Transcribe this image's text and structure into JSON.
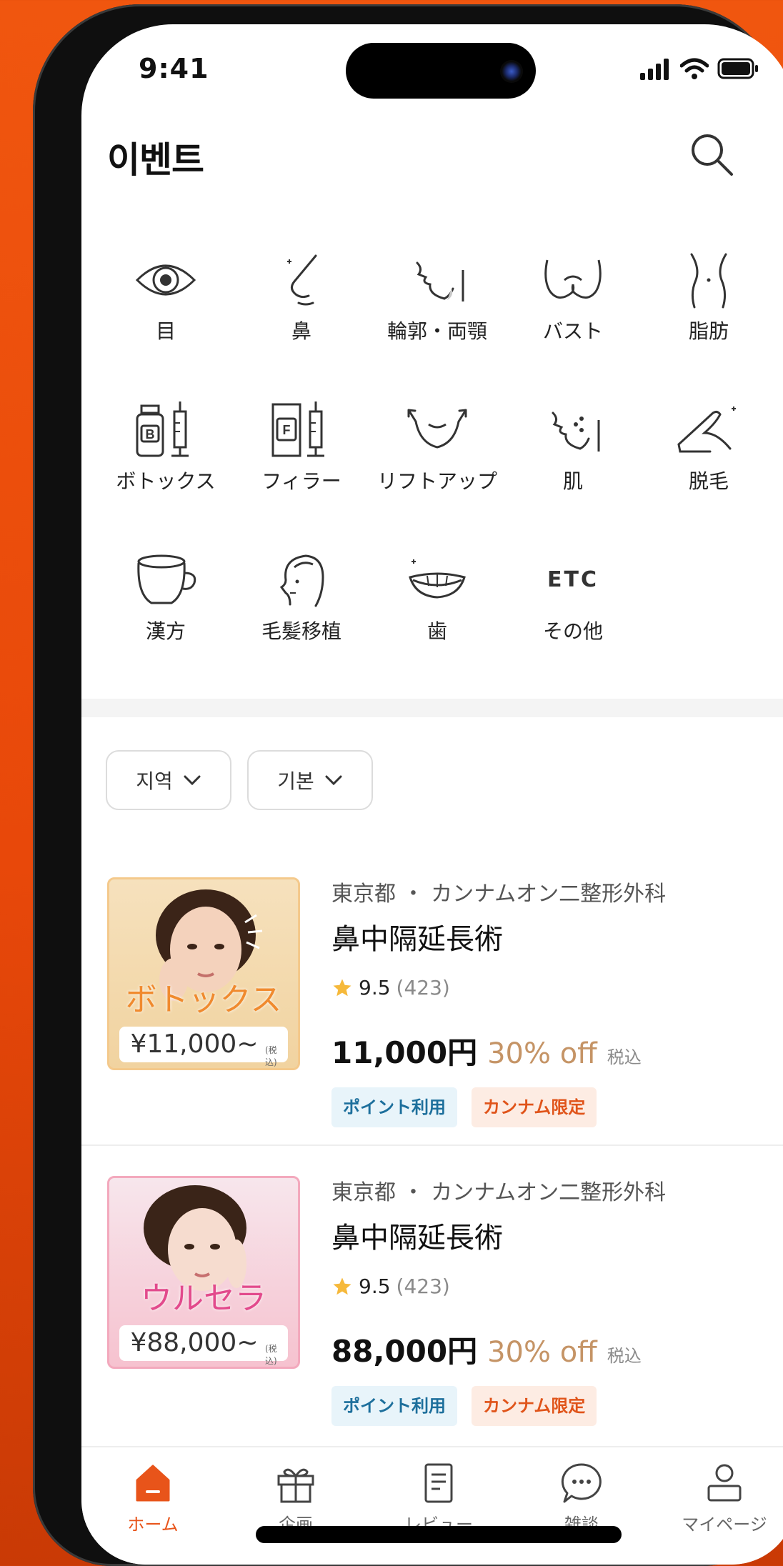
{
  "status_bar": {
    "time": "9:41"
  },
  "header": {
    "title": "이벤트"
  },
  "categories": [
    {
      "label": "目",
      "icon": "eye-icon"
    },
    {
      "label": "鼻",
      "icon": "nose-icon"
    },
    {
      "label": "輪郭・両顎",
      "icon": "jaw-icon"
    },
    {
      "label": "バスト",
      "icon": "bust-icon"
    },
    {
      "label": "脂肪",
      "icon": "waist-icon"
    },
    {
      "label": "ボトックス",
      "icon": "botox-icon"
    },
    {
      "label": "フィラー",
      "icon": "filler-icon"
    },
    {
      "label": "リフトアップ",
      "icon": "liftup-icon"
    },
    {
      "label": "肌",
      "icon": "skin-icon"
    },
    {
      "label": "脱毛",
      "icon": "hair-removal-icon"
    },
    {
      "label": "漢方",
      "icon": "herbal-pot-icon"
    },
    {
      "label": "毛髪移植",
      "icon": "hair-transplant-icon"
    },
    {
      "label": "歯",
      "icon": "teeth-icon"
    },
    {
      "label": "その他",
      "icon": "etc-icon",
      "icon_text": "ETC"
    }
  ],
  "filters": [
    {
      "label": "지역"
    },
    {
      "label": "기본"
    }
  ],
  "products": [
    {
      "location": "東京都 ・ カンナムオン二整形外科",
      "title": "鼻中隔延長術",
      "rating": "9.5",
      "review_count": "(423)",
      "price": "11,000円",
      "discount": "30% off",
      "tax": "税込",
      "tags": [
        "ポイント利用",
        "カンナム限定"
      ],
      "thumb": {
        "headline": "ボトックス",
        "price": "¥11,000~",
        "tax_small": "(税込)",
        "theme": "#f0d39a"
      }
    },
    {
      "location": "東京都 ・ カンナムオン二整形外科",
      "title": "鼻中隔延長術",
      "rating": "9.5",
      "review_count": "(423)",
      "price": "88,000円",
      "discount": "30% off",
      "tax": "税込",
      "tags": [
        "ポイント利用",
        "カンナム限定"
      ],
      "thumb": {
        "headline": "ウルセラ",
        "price": "¥88,000~",
        "tax_small": "(税込)",
        "theme": "#f4a3b8"
      }
    }
  ],
  "tab_bar": [
    {
      "label": "ホーム",
      "icon": "home-icon",
      "active": true
    },
    {
      "label": "企画",
      "icon": "gift-icon",
      "active": false
    },
    {
      "label": "レビュー",
      "icon": "document-icon",
      "active": false
    },
    {
      "label": "雑談",
      "icon": "chat-bubble-icon",
      "active": false
    },
    {
      "label": "マイページ",
      "icon": "person-icon",
      "active": false
    }
  ],
  "colors": {
    "accent": "#e8541a",
    "frame": "#f0560f",
    "discount": "#c59466",
    "tag_point": "#1d6f9c",
    "tag_limit": "#e0541a"
  }
}
